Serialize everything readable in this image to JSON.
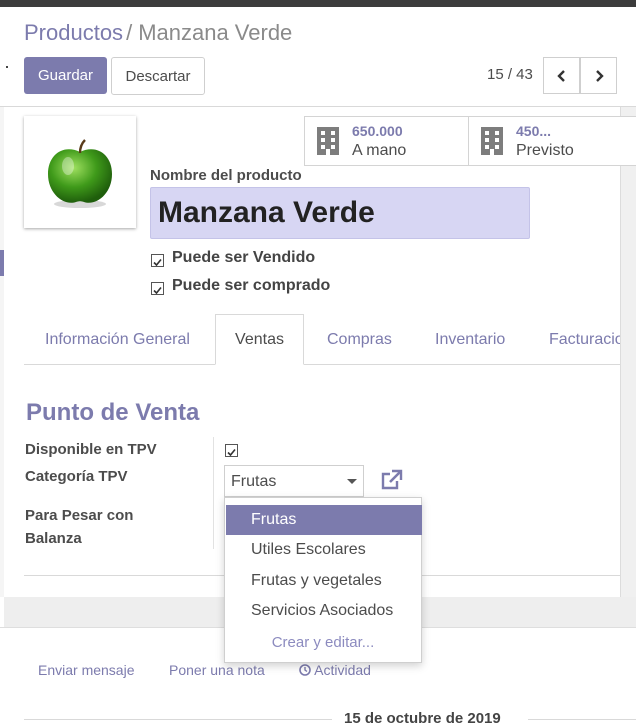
{
  "breadcrumb": {
    "parent": "Productos",
    "separator": "/",
    "current": "Manzana Verde"
  },
  "toolbar": {
    "save_label": "Guardar",
    "discard_label": "Descartar"
  },
  "pager": {
    "text": "15 / 43"
  },
  "stats": [
    {
      "value": "650.000",
      "label": "A mano",
      "icon": "building-icon"
    },
    {
      "value": "450...",
      "label": "Previsto",
      "icon": "building-icon"
    }
  ],
  "product": {
    "name_label": "Nombre del producto",
    "name_value": "Manzana Verde",
    "image_alt": "green-apple",
    "can_be_sold_label": "Puede ser Vendido",
    "can_be_sold": true,
    "can_be_purchased_label": "Puede ser comprado",
    "can_be_purchased": true
  },
  "tabs": [
    {
      "label": "Información General",
      "active": false
    },
    {
      "label": "Ventas",
      "active": true
    },
    {
      "label": "Compras",
      "active": false
    },
    {
      "label": "Inventario",
      "active": false
    },
    {
      "label": "Facturacio",
      "active": false
    }
  ],
  "pos": {
    "section_title": "Punto de Venta",
    "available_label": "Disponible en TPV",
    "available": true,
    "category_label": "Categoría TPV",
    "category_value": "Frutas",
    "weigh_label_line1": "Para Pesar con",
    "weigh_label_line2": "Balanza"
  },
  "dropdown": {
    "options": [
      "Frutas",
      "Utiles Escolares",
      "Frutas y vegetales",
      "Servicios Asociados"
    ],
    "selected": "Frutas",
    "create_label": "Crear y editar..."
  },
  "chatter": {
    "send_message": "Enviar mensaje",
    "log_note": "Poner una nota",
    "activity": "Actividad",
    "date_separator": "15 de octubre de 2019"
  },
  "colors": {
    "accent": "#7c7bad",
    "name_field_bg": "#d7d6f3",
    "apple": "#3f9a1a"
  }
}
